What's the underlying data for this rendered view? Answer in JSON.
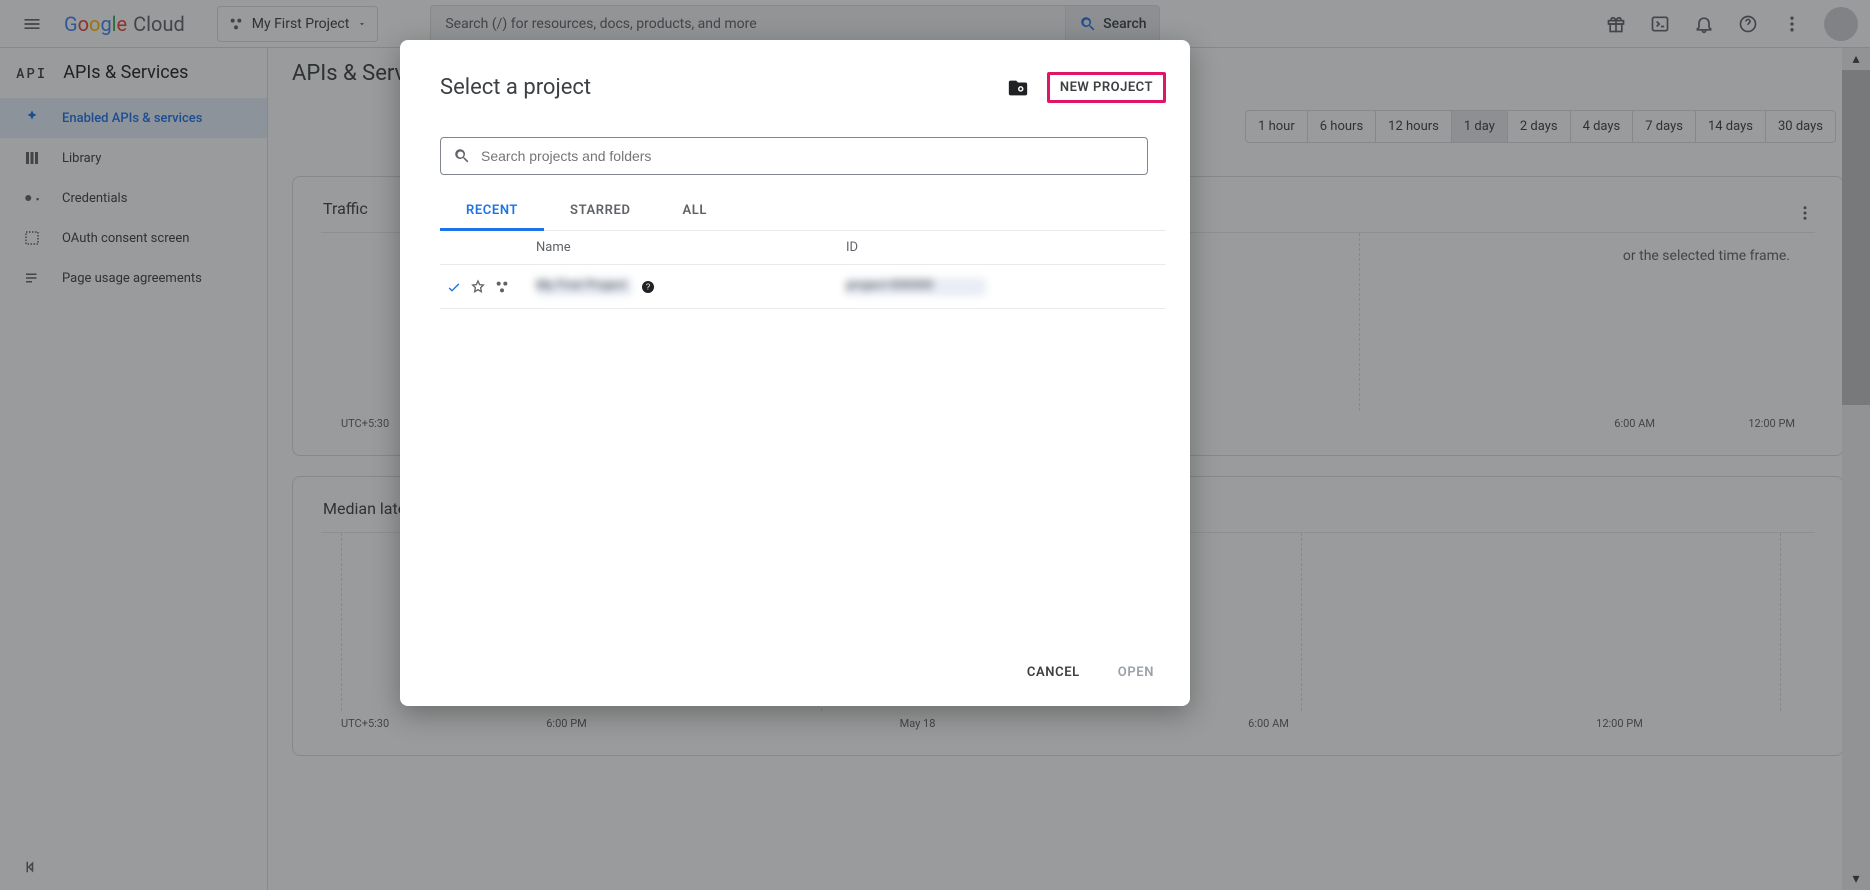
{
  "header": {
    "logo_cloud": "Cloud",
    "project_chip": "My First Project",
    "search_placeholder": "Search (/) for resources, docs, products, and more",
    "search_button": "Search"
  },
  "subheader": {
    "api_badge": "API",
    "section_title": "APIs & Services",
    "page_title": "APIs & Services"
  },
  "sidebar": {
    "items": [
      {
        "label": "Enabled APIs & services"
      },
      {
        "label": "Library"
      },
      {
        "label": "Credentials"
      },
      {
        "label": "OAuth consent screen"
      },
      {
        "label": "Page usage agreements"
      }
    ]
  },
  "time_range": {
    "items": [
      "1 hour",
      "6 hours",
      "12 hours",
      "1 day",
      "2 days",
      "4 days",
      "7 days",
      "14 days",
      "30 days"
    ],
    "active_index": 3
  },
  "traffic_card": {
    "title": "Traffic",
    "no_data": "or the selected time frame.",
    "axis": {
      "tz": "UTC+5:30",
      "labels": [
        "6:00 AM",
        "12:00 PM"
      ]
    }
  },
  "latency_card": {
    "title": "Median latency",
    "axis": {
      "tz": "UTC+5:30",
      "labels": [
        "6:00 PM",
        "May 18",
        "6:00 AM",
        "12:00 PM"
      ]
    }
  },
  "modal": {
    "title": "Select a project",
    "new_project": "NEW PROJECT",
    "search_placeholder": "Search projects and folders",
    "tabs": [
      "RECENT",
      "STARRED",
      "ALL"
    ],
    "columns": {
      "name": "Name",
      "id": "ID"
    },
    "row": {
      "name_hidden": "My First Project",
      "id_hidden": "project-000000"
    },
    "cancel": "CANCEL",
    "open": "OPEN"
  }
}
